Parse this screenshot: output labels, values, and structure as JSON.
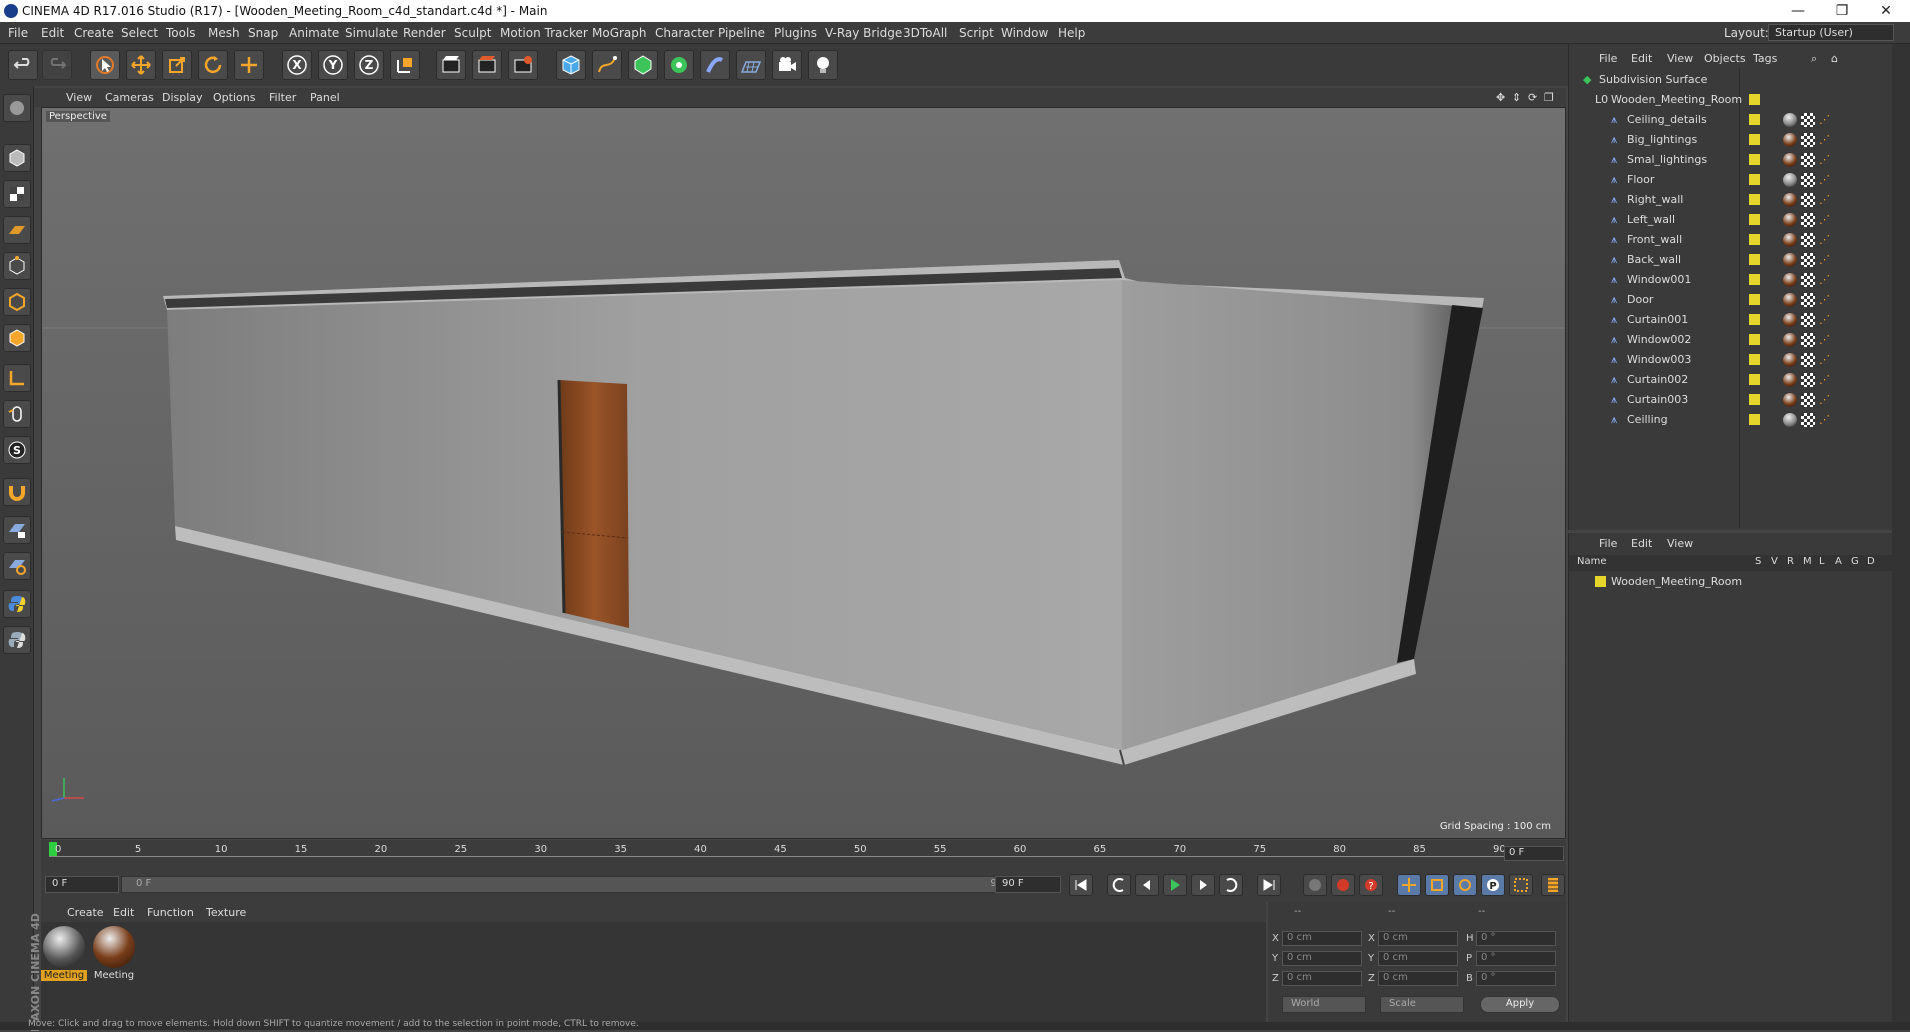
{
  "window": {
    "title": "CINEMA 4D R17.016 Studio (R17) - [Wooden_Meeting_Room_c4d_standart.c4d *] - Main",
    "controls": [
      "minimize-icon",
      "restore-icon",
      "close-icon"
    ]
  },
  "menubar": {
    "items": [
      "File",
      "Edit",
      "Create",
      "Select",
      "Tools",
      "Mesh",
      "Snap",
      "Animate",
      "Simulate",
      "Render",
      "Sculpt",
      "Motion Tracker",
      "MoGraph",
      "Character",
      "Pipeline",
      "Plugins",
      "V-Ray Bridge",
      "3DToAll",
      "Script",
      "Window",
      "Help"
    ],
    "layout_label": "Layout:",
    "layout_value": "Startup (User)"
  },
  "toolbar": {
    "icons": [
      "undo-icon",
      "redo-icon",
      "select-icon",
      "move-icon",
      "scale-icon",
      "rotate-icon",
      "last-tool-icon",
      "x-axis-icon",
      "y-axis-icon",
      "z-axis-icon",
      "coordinate-system-icon",
      "render-view-icon",
      "render-picture-viewer-icon",
      "edit-render-settings-icon",
      "cube-icon",
      "pen-icon",
      "subdivision-icon",
      "cloner-icon",
      "deformer-icon",
      "floor-icon",
      "camera-icon",
      "light-icon"
    ]
  },
  "viewport": {
    "menu": [
      "View",
      "Cameras",
      "Display",
      "Options",
      "Filter",
      "Panel"
    ],
    "label": "Perspective",
    "grid_spacing": "Grid Spacing : 100 cm"
  },
  "timeline": {
    "ticks": [
      "0",
      "5",
      "10",
      "15",
      "20",
      "25",
      "30",
      "35",
      "40",
      "45",
      "50",
      "55",
      "60",
      "65",
      "70",
      "75",
      "80",
      "85",
      "90"
    ],
    "current_frame": "0 F",
    "start_field": "0 F",
    "range_start": "0 F",
    "range_end": "90 F",
    "end_field": "90 F"
  },
  "materials": {
    "menu": [
      "Create",
      "Edit",
      "Function",
      "Texture"
    ],
    "items": [
      {
        "label": "Meeting",
        "selected": true
      },
      {
        "label": "Meeting",
        "selected": false
      }
    ]
  },
  "coordinates": {
    "headers": [
      "--",
      "--",
      "--"
    ],
    "rows": [
      {
        "a": "X",
        "av": "0 cm",
        "b": "X",
        "bv": "0 cm",
        "c": "H",
        "cv": "0 °"
      },
      {
        "a": "Y",
        "av": "0 cm",
        "b": "Y",
        "bv": "0 cm",
        "c": "P",
        "cv": "0 °"
      },
      {
        "a": "Z",
        "av": "0 cm",
        "b": "Z",
        "bv": "0 cm",
        "c": "B",
        "cv": "0 °"
      }
    ],
    "mode1": "World",
    "mode2": "Scale",
    "apply": "Apply"
  },
  "objects": {
    "menu": [
      "File",
      "Edit",
      "View",
      "Objects",
      "Tags"
    ],
    "tree": [
      "Subdivision Surface",
      "Wooden_Meeting_Room",
      "Ceiling_details",
      "Big_lightings",
      "Smal_lightings",
      "Floor",
      "Right_wall",
      "Left_wall",
      "Front_wall",
      "Back_wall",
      "Window001",
      "Door",
      "Curtain001",
      "Window002",
      "Window003",
      "Curtain002",
      "Curtain003",
      "Ceilling"
    ]
  },
  "layers": {
    "menu": [
      "File",
      "Edit",
      "View"
    ],
    "header": {
      "name": "Name",
      "cols": [
        "S",
        "V",
        "R",
        "M",
        "L",
        "A",
        "G",
        "D"
      ]
    },
    "row": "Wooden_Meeting_Room"
  },
  "status": "Move: Click and drag to move elements. Hold down SHIFT to quantize movement / add to the selection in point mode, CTRL to remove.",
  "brand": "MAXON CINEMA 4D",
  "colors": {
    "accent": "#e6d52a",
    "playhead": "#2ecc40",
    "door": "#8b4a22"
  }
}
